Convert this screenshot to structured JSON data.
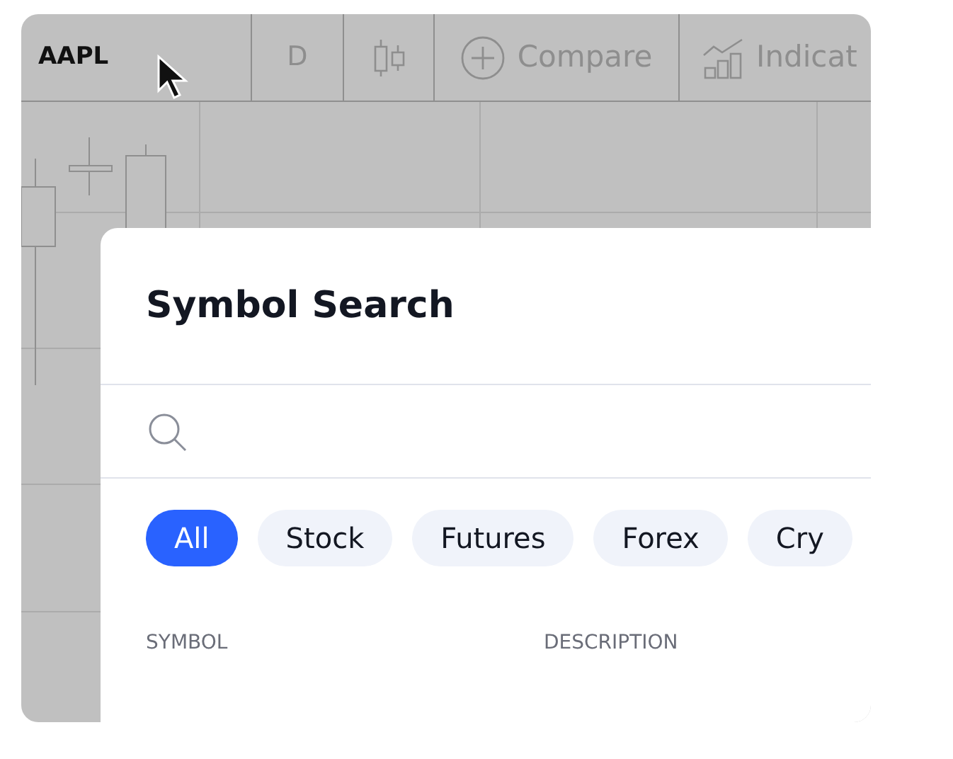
{
  "toolbar": {
    "symbol": "AAPL",
    "interval": "D",
    "compare": "Compare",
    "indicators": "Indicat"
  },
  "dialog": {
    "title": "Symbol Search",
    "filters": [
      {
        "label": "All",
        "selected": true
      },
      {
        "label": "Stock",
        "selected": false
      },
      {
        "label": "Futures",
        "selected": false
      },
      {
        "label": "Forex",
        "selected": false
      },
      {
        "label": "Cry",
        "selected": false
      }
    ],
    "columns": [
      "SYMBOL",
      "DESCRIPTION"
    ]
  }
}
